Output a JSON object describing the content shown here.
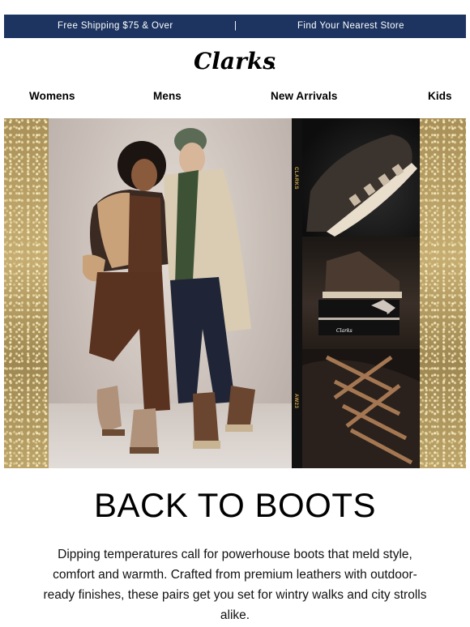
{
  "topbar": {
    "shipping_text": "Free Shipping $75 & Over",
    "separator": "|",
    "store_text": "Find Your Nearest Store",
    "bg_color": "#1d3461"
  },
  "brand": {
    "logo_text": "Clarks"
  },
  "nav": {
    "items": [
      {
        "label": "Womens"
      },
      {
        "label": "Mens"
      },
      {
        "label": "New Arrivals"
      },
      {
        "label": "Kids"
      }
    ]
  },
  "hero": {
    "strip_labels": [
      "CLARKS",
      "AW23"
    ],
    "box_logo": "Clarks"
  },
  "content": {
    "headline": "BACK TO BOOTS",
    "body": "Dipping temperatures call for powerhouse boots that meld style, comfort and warmth. Crafted from premium leathers with outdoor-ready finishes, these pairs get you set for wintry walks and city strolls alike."
  }
}
